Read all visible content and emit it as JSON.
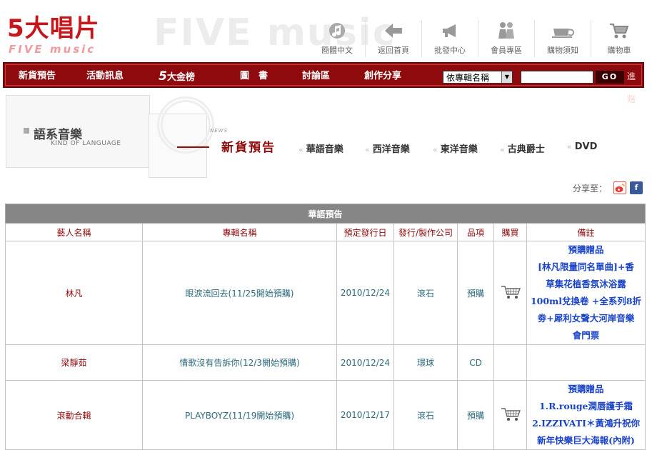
{
  "header": {
    "logo_main": "5大唱片",
    "logo_sub": "FIVE music",
    "logo_ghost": "FIVE music",
    "topnav": [
      {
        "icon": "music-note-icon",
        "label": "簡體中文"
      },
      {
        "icon": "back-arrow-icon",
        "label": "返回首頁"
      },
      {
        "icon": "megaphone-icon",
        "label": "批發中心"
      },
      {
        "icon": "members-icon",
        "label": "會員專區"
      },
      {
        "icon": "teacup-icon",
        "label": "購物須知"
      },
      {
        "icon": "cart-icon",
        "label": "購物車"
      }
    ]
  },
  "menubar": {
    "items": [
      "新貨預告",
      "活動訊息",
      "5",
      "大金榜",
      "圖　書",
      "討論區",
      "創作分享"
    ],
    "search_select": "依專輯名稱",
    "search_value": "",
    "go_label": "GO",
    "adv_label": "進階"
  },
  "banner": {
    "title": "語系音樂",
    "subtitle": "KIND OF LANGUAGE",
    "news_tag": "NEWS",
    "news_title": "新貨預告",
    "categories": [
      "華語音樂",
      "西洋音樂",
      "東洋音樂",
      "古典爵士",
      "DVD"
    ]
  },
  "share": {
    "label": "分享至："
  },
  "table": {
    "caption": "華語預告",
    "columns": [
      "藝人名稱",
      "專輯名稱",
      "預定發行日",
      "發行/製作公司",
      "品項",
      "購買",
      "備註"
    ],
    "rows": [
      {
        "artist": "林凡",
        "album": "眼淚流回去(11/25開始預購)",
        "date": "2010/12/24",
        "company": "滾石",
        "product": "預購",
        "cart": true,
        "note": [
          "預購贈品",
          "[林凡限量同名單曲]+香",
          "草集花植香氛沐浴露",
          "100ml兌換卷 +全系列8折",
          "劵+犀利女聲大河岸音樂",
          "會門票"
        ]
      },
      {
        "artist": "梁靜茹",
        "album": "情歌沒有告訴你(12/3開始預購)",
        "date": "2010/12/24",
        "company": "環球",
        "product": "CD",
        "cart": false,
        "note": []
      },
      {
        "artist": "滾動合輯",
        "album": "PLAYBOYZ(11/19開始預購)",
        "date": "2010/12/17",
        "company": "滾石",
        "product": "預購",
        "cart": true,
        "note": [
          "預購贈品",
          "1.R.rouge潤唇護手霜",
          "2.IZZIVATI＊黃鴻升祝你",
          "新年快樂巨大海報(內附)"
        ]
      }
    ]
  }
}
